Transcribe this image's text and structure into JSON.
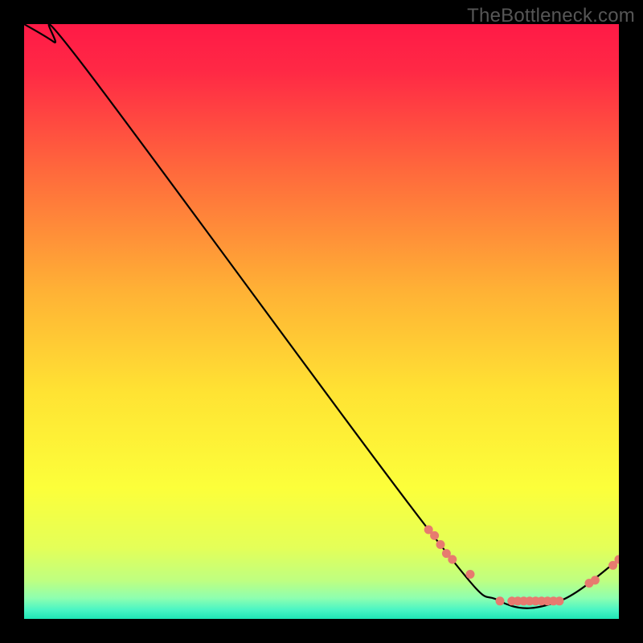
{
  "watermark": "TheBottleneck.com",
  "chart_data": {
    "type": "line",
    "title": "",
    "xlabel": "",
    "ylabel": "",
    "xlim": [
      0,
      100
    ],
    "ylim": [
      0,
      100
    ],
    "series": [
      {
        "name": "bottleneck-curve",
        "x": [
          0,
          5,
          10,
          68,
          80,
          90,
          100
        ],
        "values": [
          100,
          97,
          93,
          15,
          3,
          3,
          10
        ]
      }
    ],
    "markers": {
      "name": "highlight-points",
      "color": "#e77a6f",
      "x": [
        68,
        69,
        70,
        71,
        72,
        75,
        80,
        82,
        83,
        84,
        85,
        86,
        87,
        88,
        89,
        90,
        95,
        96,
        99,
        100
      ],
      "values": [
        15,
        14,
        12.5,
        11,
        10,
        7.5,
        3,
        3,
        3,
        3,
        3,
        3,
        3,
        3,
        3,
        3,
        6,
        6.5,
        9,
        10
      ]
    },
    "gradient_stops": [
      {
        "offset": 0.0,
        "color": "#ff1a46"
      },
      {
        "offset": 0.08,
        "color": "#ff2945"
      },
      {
        "offset": 0.25,
        "color": "#ff6a3c"
      },
      {
        "offset": 0.45,
        "color": "#ffb235"
      },
      {
        "offset": 0.62,
        "color": "#ffe333"
      },
      {
        "offset": 0.78,
        "color": "#fcff3a"
      },
      {
        "offset": 0.88,
        "color": "#e4ff58"
      },
      {
        "offset": 0.935,
        "color": "#bfff80"
      },
      {
        "offset": 0.965,
        "color": "#8effb0"
      },
      {
        "offset": 0.985,
        "color": "#49f5c4"
      },
      {
        "offset": 1.0,
        "color": "#1ee6b6"
      }
    ]
  }
}
